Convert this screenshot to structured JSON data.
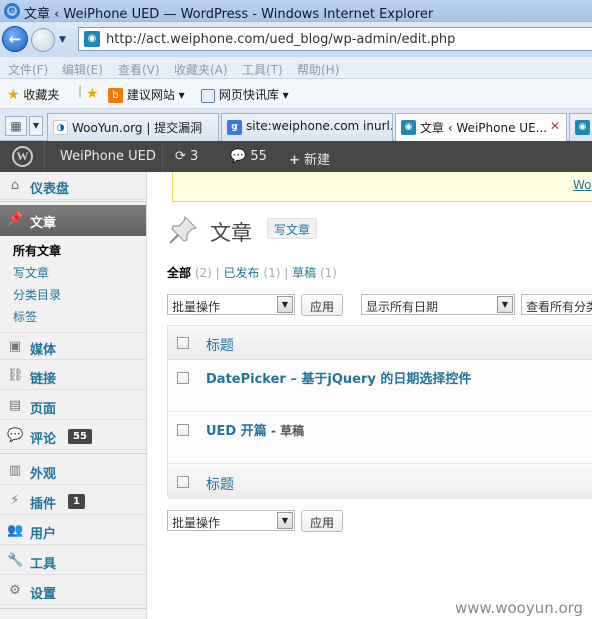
{
  "window": {
    "title": "文章 ‹ WeiPhone UED — WordPress - Windows Internet Explorer"
  },
  "browser": {
    "url": "http://act.weiphone.com/ued_blog/wp-admin/edit.php",
    "menu": [
      "文件(F)",
      "编辑(E)",
      "查看(V)",
      "收藏夹(A)",
      "工具(T)",
      "帮助(H)"
    ],
    "favorites_label": "收藏夹",
    "fav_links": [
      "建议网站 ▾",
      "网页快讯库 ▾"
    ],
    "tabs": [
      "WooYun.org | 提交漏洞",
      "site:weiphone.com inurl...",
      "文章 ‹ WeiPhone UE..."
    ]
  },
  "adminbar": {
    "site_name": "WeiPhone UED",
    "updates": "3",
    "comments": "55",
    "new_label": "新建"
  },
  "sidebar": {
    "dashboard": "仪表盘",
    "posts": "文章",
    "posts_sub": [
      "所有文章",
      "写文章",
      "分类目录",
      "标签"
    ],
    "media": "媒体",
    "links": "链接",
    "pages": "页面",
    "comments": "评论",
    "comments_count": "55",
    "appearance": "外观",
    "plugins": "插件",
    "plugins_count": "1",
    "users": "用户",
    "tools": "工具",
    "settings": "设置"
  },
  "main": {
    "notice_link": "Wo",
    "title": "文章",
    "add_new": "写文章",
    "filters": {
      "all_label": "全部",
      "all_count": "(2)",
      "published_label": "已发布",
      "published_count": "(1)",
      "draft_label": "草稿",
      "draft_count": "(1)"
    },
    "bulk_action": "批量操作",
    "apply": "应用",
    "date_filter": "显示所有日期",
    "category_filter": "查看所有分类",
    "column_title": "标题",
    "posts": [
      {
        "title": "DatePicker – 基于jQuery 的日期选择控件",
        "state": ""
      },
      {
        "title": "UED 开篇",
        "state": " - 草稿"
      }
    ]
  },
  "watermark": "www.wooyun.org"
}
